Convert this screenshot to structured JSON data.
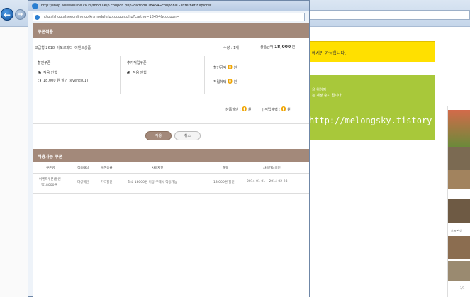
{
  "background": {
    "yellow_notice": "에서만 가능합니다.",
    "green_line1": "을 위하여",
    "green_line2": "는 계정 충고 됩니다.",
    "watermark_url": "http://melongsky.tistory",
    "sidebar_text": "오늘본 상",
    "sidebar_page": "1/1"
  },
  "window": {
    "title": "http://shop.alseeonline.co.kr/module/p.coupon.php?cartno=18454&coupon= - Internet Explorer",
    "address": "http://shop.alseeonline.co.kr/module/p.coupon.php?cartno=18454&coupon="
  },
  "coupon_apply": {
    "title": "쿠폰적용",
    "product_name": "고급형 2618_아모르파티_이벤트상품",
    "quantity": "수량 : 1개",
    "price_label": "상품금액",
    "price_value": "18,000",
    "price_unit": "원",
    "discount_coupon_label": "할인쿠폰",
    "discount_options": [
      "적용 안함",
      "18,000 원 할인 (events01)"
    ],
    "extra_coupon_label": "추가적립쿠폰",
    "extra_options": [
      "적용 안함"
    ],
    "discount_amount_label": "할인금액",
    "discount_amount_value": "0",
    "discount_amount_unit": "원",
    "points_label": "적립혜택",
    "points_value": "0",
    "points_unit": "원",
    "product_discount_label": "상품할인 :",
    "product_discount_value": "0",
    "product_discount_unit": "원",
    "points_benefit_label": "| 적립혜택 :",
    "points_benefit_value": "0",
    "points_benefit_unit": "원",
    "apply_button": "적용",
    "cancel_button": "취소"
  },
  "available_coupons": {
    "title": "적용가능 쿠폰",
    "columns": [
      "쿠폰명",
      "적용대상",
      "쿠폰종류",
      "사용제한",
      "혜택",
      "사용가능기간"
    ],
    "rows": [
      {
        "name_line1": "이벤트쿠폰(할인",
        "name_line2": "액18000원",
        "target": "대상확인",
        "type": "가격할인",
        "restriction": "최소 18000원 이상 구매시 적용가능",
        "benefit": "18,000원 할인",
        "period": "2014-01-01 ~2014-02-28"
      }
    ]
  }
}
